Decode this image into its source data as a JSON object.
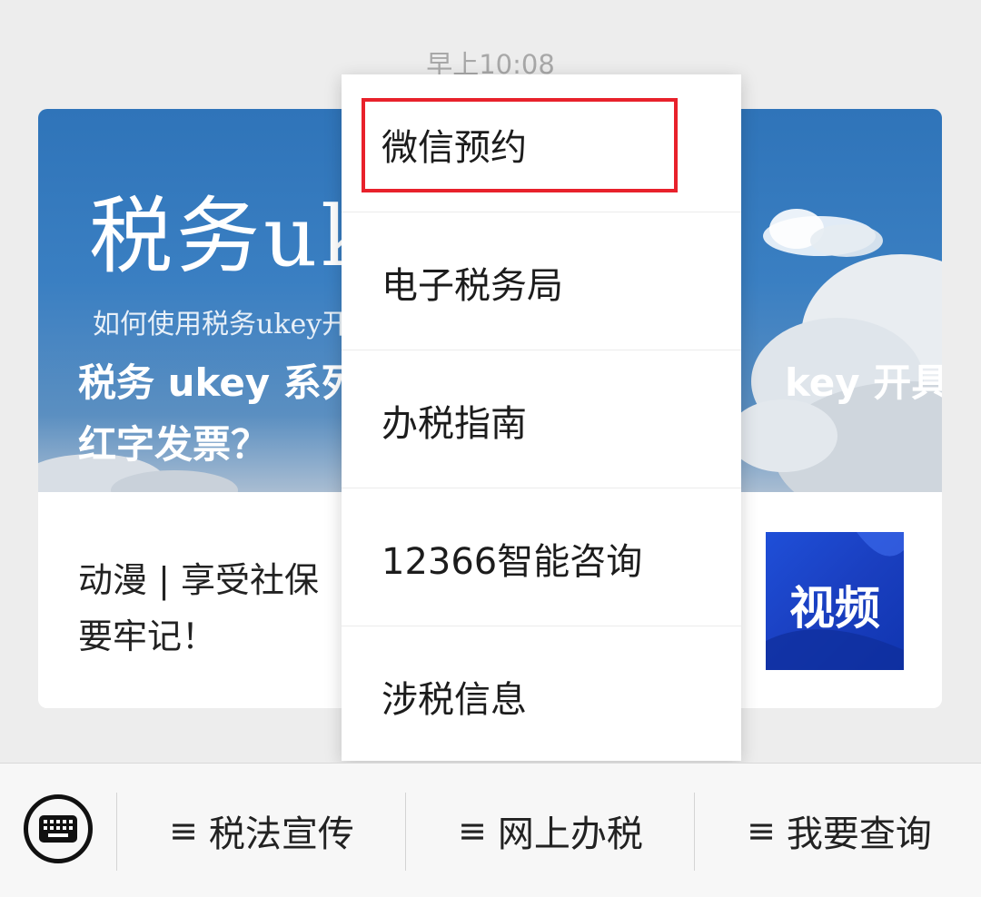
{
  "chat": {
    "timestamp": "早上10:08"
  },
  "article_card": {
    "cover_title": "税务uk",
    "cover_subtitle": "如何使用税务ukey开",
    "headline_line1_left": "税务 ukey 系列",
    "headline_line1_right": "key 开具",
    "headline_line2": "红字发票？",
    "item_text_line1": "动漫 | 享受社保",
    "item_text_line2": "要牢记！",
    "video_label": "视频",
    "colors": {
      "cover_blue": "#2f74b9",
      "video_blue": "#1a3fc0"
    }
  },
  "popup_menu": {
    "items": [
      {
        "label": "微信预约",
        "highlighted": true
      },
      {
        "label": "电子税务局"
      },
      {
        "label": "办税指南"
      },
      {
        "label": "12366智能咨询"
      },
      {
        "label": "涉税信息"
      }
    ],
    "highlight_color": "#e8212b"
  },
  "bottom_menu": {
    "keyboard_icon": "keyboard-icon",
    "tabs": [
      {
        "icon": "≡",
        "label": "税法宣传"
      },
      {
        "icon": "≡",
        "label": "网上办税"
      },
      {
        "icon": "≡",
        "label": "我要查询"
      }
    ]
  }
}
